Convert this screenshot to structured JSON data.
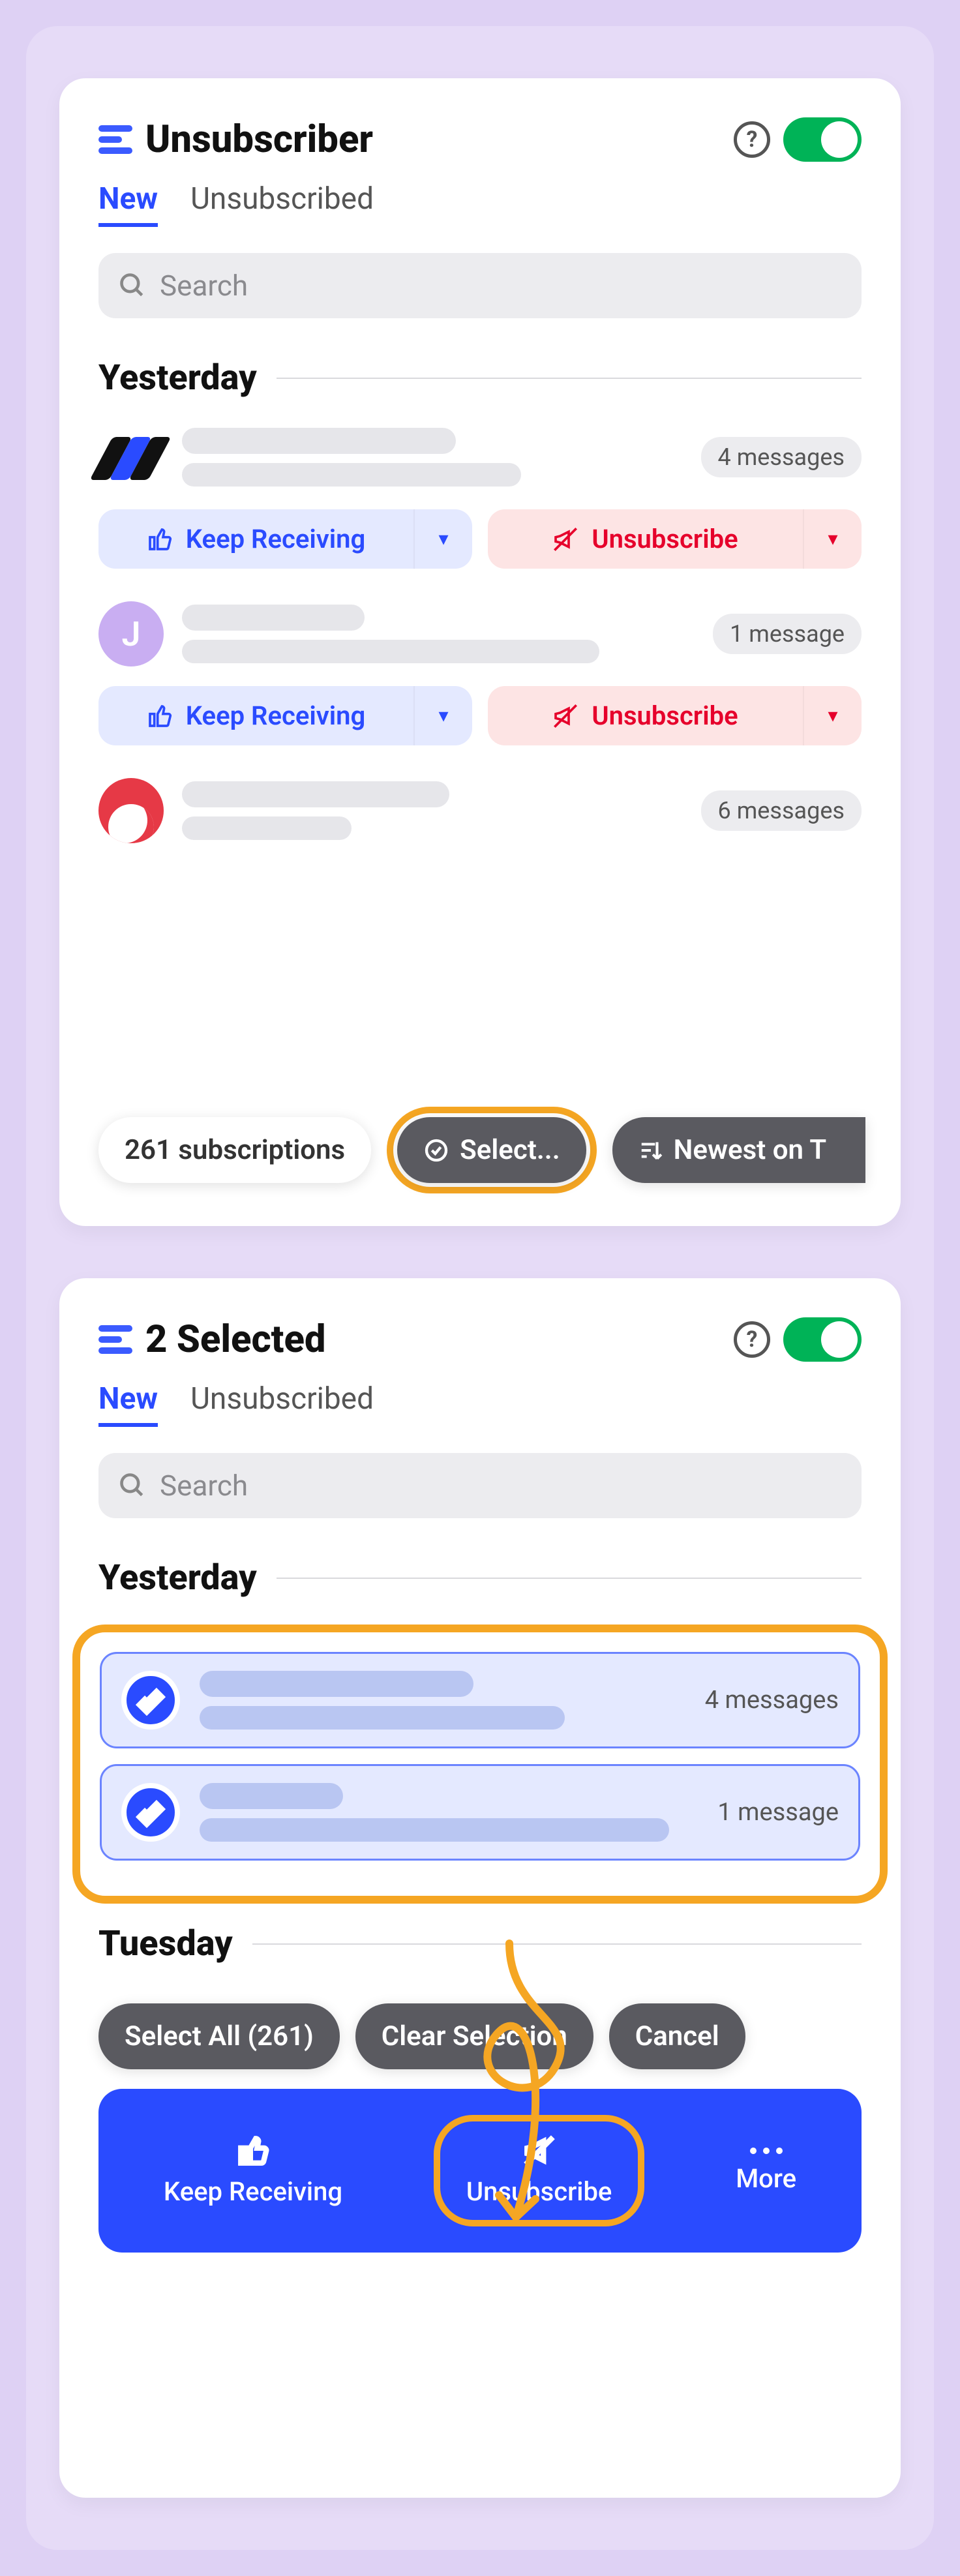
{
  "card1": {
    "title": "Unsubscriber",
    "tabs": {
      "new": "New",
      "unsub": "Unsubscribed"
    },
    "search_placeholder": "Search",
    "section": "Yesterday",
    "items": [
      {
        "avatar_letter": "",
        "count": "4 messages"
      },
      {
        "avatar_letter": "J",
        "count": "1 message"
      },
      {
        "avatar_letter": "",
        "count": "6 messages"
      }
    ],
    "keep_label": "Keep Receiving",
    "unsub_label": "Unsubscribe",
    "sub_count": "261 subscriptions",
    "select_label": "Select...",
    "sort_label": "Newest on T"
  },
  "card2": {
    "title": "2 Selected",
    "tabs": {
      "new": "New",
      "unsub": "Unsubscribed"
    },
    "search_placeholder": "Search",
    "section1": "Yesterday",
    "section2": "Tuesday",
    "sel_items": [
      {
        "count": "4 messages"
      },
      {
        "count": "1 message"
      }
    ],
    "toolbar": {
      "select_all": "Select All (261)",
      "clear": "Clear Selection",
      "cancel": "Cancel"
    },
    "actions": {
      "keep": "Keep Receiving",
      "unsub": "Unsubscribe",
      "more": "More"
    }
  }
}
